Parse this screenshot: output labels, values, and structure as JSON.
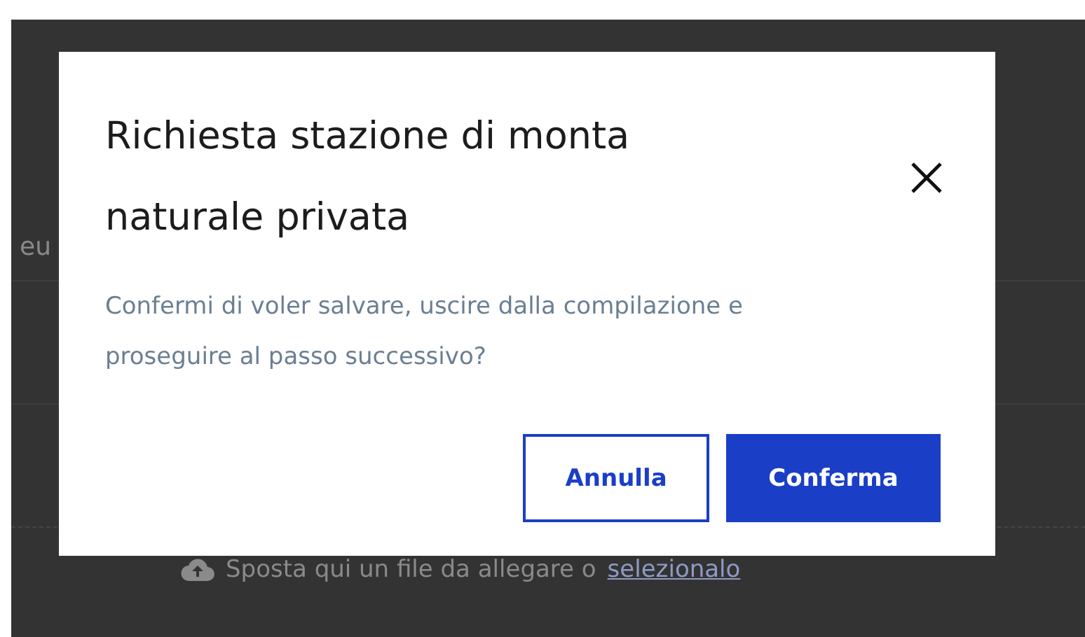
{
  "background": {
    "partial_text": "eu",
    "upload_hint": "Sposta qui un file da allegare o",
    "upload_link": "selezionalo"
  },
  "dialog": {
    "title": "Richiesta stazione di monta naturale privata",
    "message": "Confermi di voler salvare, uscire dalla compilazione e proseguire al passo successivo?",
    "buttons": [
      {
        "label": "Annulla",
        "kind": "secondary"
      },
      {
        "label": "Conferma",
        "kind": "primary"
      }
    ]
  }
}
